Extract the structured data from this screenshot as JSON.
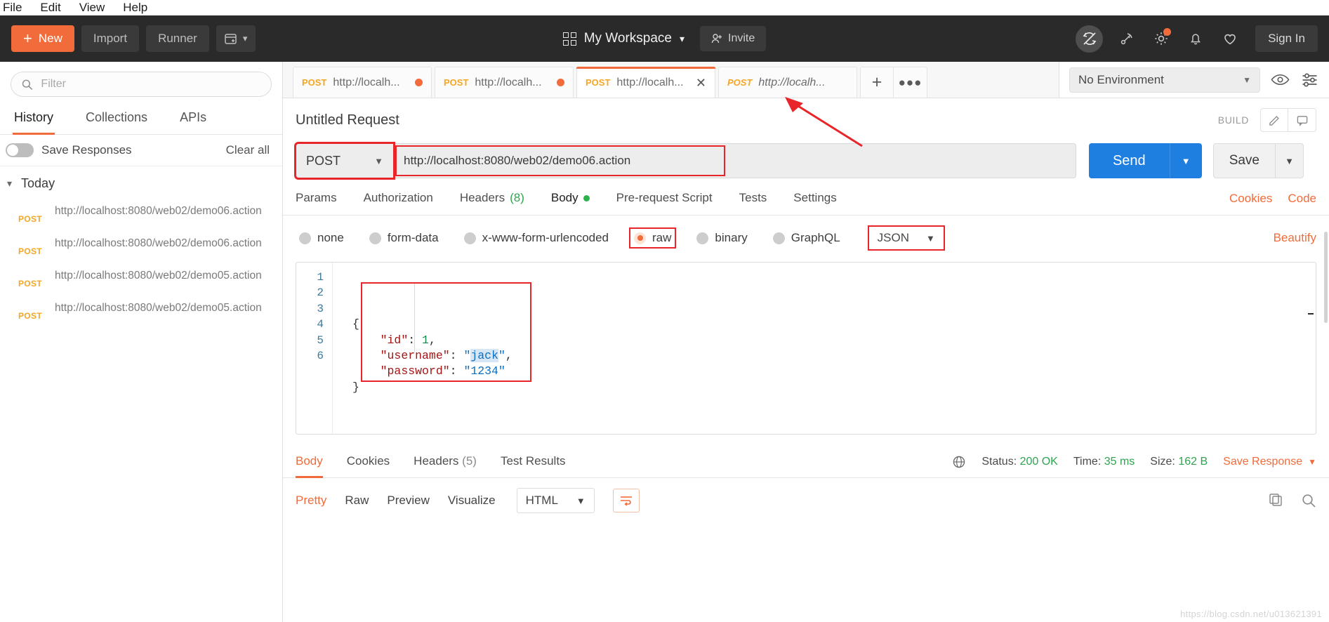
{
  "os_menu": [
    "File",
    "Edit",
    "View",
    "Help"
  ],
  "topbar": {
    "new_label": "New",
    "import_label": "Import",
    "runner_label": "Runner",
    "workspace_name": "My Workspace",
    "invite_label": "Invite",
    "signin_label": "Sign In",
    "icons": [
      "sync-off-icon",
      "satellite-icon",
      "gear-icon",
      "bell-icon",
      "heart-icon"
    ],
    "accent": "#f26b3a"
  },
  "sidebar": {
    "filter_placeholder": "Filter",
    "filter_value": "",
    "tabs": [
      {
        "label": "History",
        "active": true
      },
      {
        "label": "Collections",
        "active": false
      },
      {
        "label": "APIs",
        "active": false
      }
    ],
    "save_responses_label": "Save Responses",
    "save_responses_on": false,
    "clear_all_label": "Clear all",
    "group_label": "Today",
    "history": [
      {
        "method": "POST",
        "url": "http://localhost:8080/web02/demo06.action"
      },
      {
        "method": "POST",
        "url": "http://localhost:8080/web02/demo06.action"
      },
      {
        "method": "POST",
        "url": "http://localhost:8080/web02/demo05.action"
      },
      {
        "method": "POST",
        "url": "http://localhost:8080/web02/demo05.action"
      }
    ]
  },
  "request_tabs": [
    {
      "method": "POST",
      "url": "http://localh...",
      "unsaved": true,
      "active": false,
      "italic": false
    },
    {
      "method": "POST",
      "url": "http://localh...",
      "unsaved": true,
      "active": false,
      "italic": false
    },
    {
      "method": "POST",
      "url": "http://localh...",
      "unsaved": false,
      "active": true,
      "italic": false
    },
    {
      "method": "POST",
      "url": "http://localh...",
      "unsaved": false,
      "active": false,
      "italic": true
    }
  ],
  "tabbar": {
    "add_label": "+",
    "more_label": "●●●"
  },
  "environment": {
    "selected": "No Environment"
  },
  "request": {
    "title": "Untitled Request",
    "build_label": "BUILD",
    "method": "POST",
    "url": "http://localhost:8080/web02/demo06.action",
    "send_label": "Send",
    "save_label": "Save",
    "tabs": [
      {
        "label": "Params",
        "active": false
      },
      {
        "label": "Authorization",
        "active": false
      },
      {
        "label": "Headers",
        "count": "(8)",
        "active": false
      },
      {
        "label": "Body",
        "dot": true,
        "active": true
      },
      {
        "label": "Pre-request Script",
        "active": false
      },
      {
        "label": "Tests",
        "active": false
      },
      {
        "label": "Settings",
        "active": false
      }
    ],
    "cookies_label": "Cookies",
    "code_label": "Code",
    "body_types": [
      {
        "label": "none",
        "selected": false
      },
      {
        "label": "form-data",
        "selected": false
      },
      {
        "label": "x-www-form-urlencoded",
        "selected": false
      },
      {
        "label": "raw",
        "selected": true
      },
      {
        "label": "binary",
        "selected": false
      },
      {
        "label": "GraphQL",
        "selected": false
      }
    ],
    "raw_format": "JSON",
    "beautify_label": "Beautify",
    "editor": {
      "line_numbers": [
        "1",
        "2",
        "3",
        "4",
        "5",
        "6"
      ],
      "lines": [
        "",
        "{",
        "    \"id\": 1,",
        "    \"username\": \"jack\",",
        "    \"password\": \"1234\"",
        "}"
      ],
      "selected_text": "jack"
    }
  },
  "response": {
    "tabs": [
      {
        "label": "Body",
        "active": true
      },
      {
        "label": "Cookies",
        "active": false
      },
      {
        "label": "Headers",
        "count": "(5)",
        "active": false
      },
      {
        "label": "Test Results",
        "active": false
      }
    ],
    "status_label": "Status:",
    "status_value": "200 OK",
    "time_label": "Time:",
    "time_value": "35 ms",
    "size_label": "Size:",
    "size_value": "162 B",
    "save_response_label": "Save Response",
    "view_modes": [
      {
        "label": "Pretty",
        "active": true
      },
      {
        "label": "Raw",
        "active": false
      },
      {
        "label": "Preview",
        "active": false
      },
      {
        "label": "Visualize",
        "active": false
      }
    ],
    "format": "HTML"
  },
  "watermark": "https://blog.csdn.net/u013621391"
}
